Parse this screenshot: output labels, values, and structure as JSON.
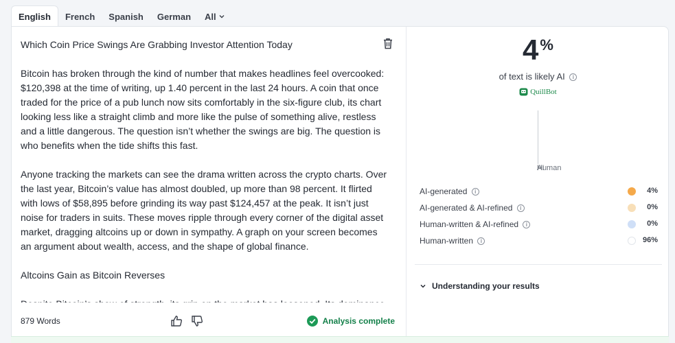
{
  "tabs": [
    {
      "label": "English",
      "active": true
    },
    {
      "label": "French"
    },
    {
      "label": "Spanish"
    },
    {
      "label": "German"
    },
    {
      "label": "All"
    }
  ],
  "document": {
    "title": "Which Coin Price Swings Are Grabbing Investor Attention Today",
    "paragraphs": [
      "Bitcoin has broken through the kind of number that makes headlines feel overcooked: $120,398 at the time of writing, up 1.40 percent in the last 24 hours. A coin that once traded for the price of a pub lunch now sits comfortably in the six-figure club, its chart looking less like a straight climb and more like the pulse of something alive, restless and a little dangerous. The question isn’t whether the swings are big. The question is who benefits when the tide shifts this fast.",
      "Anyone tracking the markets can see the drama written across the crypto charts. Over the last year, Bitcoin’s value has almost doubled, up more than 98 percent. It flirted with lows of $58,895 before grinding its way past $124,457 at the peak. It isn’t just noise for traders in suits. These moves ripple through every corner of the digital asset market, dragging altcoins up or down in sympathy. A graph on your screen becomes an argument about wealth, access, and the shape of global finance.",
      "Altcoins Gain as Bitcoin Reverses",
      "Despite Bitcoin’s show of strength, its grip on the market has loosened. Its dominance now"
    ],
    "word_count": "879 Words",
    "status": "Analysis complete"
  },
  "result": {
    "percent": "4",
    "percent_sign": "%",
    "likely_text": "of text is likely AI",
    "brand": "QuillBot",
    "scale_label": "Human",
    "scale_overlap": "AI",
    "rows": [
      {
        "label": "AI-generated",
        "value": "4%",
        "color": "#f5a94a"
      },
      {
        "label": "AI-generated & AI-refined",
        "value": "0%",
        "color": "#f8dfb8"
      },
      {
        "label": "Human-written & AI-refined",
        "value": "0%",
        "color": "#cfdff7"
      },
      {
        "label": "Human-written",
        "value": "96%",
        "color": "#ffffff"
      }
    ],
    "understanding": "Understanding your results"
  }
}
